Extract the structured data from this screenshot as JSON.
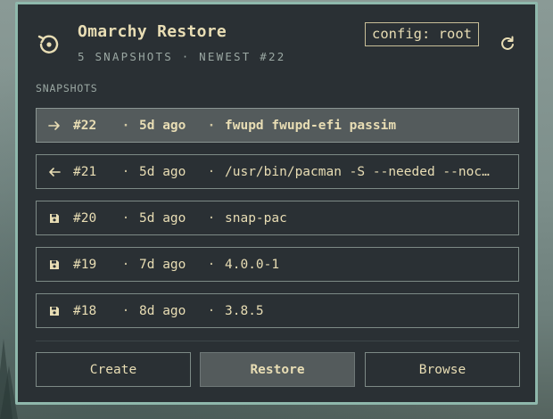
{
  "window": {
    "title": "Omarchy Restore",
    "subtitle": "5 SNAPSHOTS · NEWEST #22",
    "config_badge": "config: root",
    "app_icon": "restore-history-icon",
    "refresh_icon": "refresh-icon"
  },
  "snapshots_section": {
    "label": "SNAPSHOTS",
    "items": [
      {
        "icon": "arrow-right-icon",
        "number": "#22",
        "sep1": "·",
        "age": "5d ago",
        "sep2": "·",
        "description": "fwupd fwupd-efi passim",
        "selected": true
      },
      {
        "icon": "arrow-left-icon",
        "number": "#21",
        "sep1": "·",
        "age": "5d ago",
        "sep2": "·",
        "description": "/usr/bin/pacman -S --needed --noc…",
        "selected": false
      },
      {
        "icon": "save-icon",
        "number": "#20",
        "sep1": "·",
        "age": "5d ago",
        "sep2": "·",
        "description": "snap-pac",
        "selected": false
      },
      {
        "icon": "save-icon",
        "number": "#19",
        "sep1": "·",
        "age": "7d ago",
        "sep2": "·",
        "description": "4.0.0-1",
        "selected": false
      },
      {
        "icon": "save-icon",
        "number": "#18",
        "sep1": "·",
        "age": "8d ago",
        "sep2": "·",
        "description": "3.8.5",
        "selected": false
      }
    ]
  },
  "actions": {
    "create": "Create",
    "restore": "Restore",
    "browse": "Browse"
  },
  "colors": {
    "accent_border": "#8fb8ac",
    "panel_bg": "#2a3034",
    "text": "#e8ddb4",
    "muted_text": "#9aa7a2",
    "selected_bg": "#545b5c"
  }
}
